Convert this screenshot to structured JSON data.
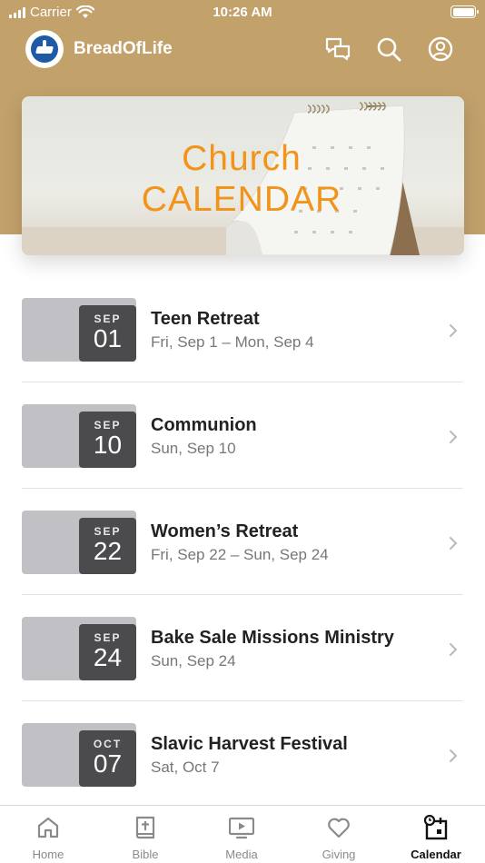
{
  "status_bar": {
    "carrier": "Carrier",
    "time": "10:26 AM"
  },
  "header": {
    "app_name": "BreadOfLife"
  },
  "banner": {
    "line1": "Church",
    "line2": "CALENDAR"
  },
  "events": [
    {
      "month": "SEP",
      "day": "01",
      "title": "Teen Retreat",
      "date_range": "Fri, Sep 1 – Mon, Sep 4"
    },
    {
      "month": "SEP",
      "day": "10",
      "title": "Communion",
      "date_range": "Sun, Sep 10"
    },
    {
      "month": "SEP",
      "day": "22",
      "title": "Women’s Retreat",
      "date_range": "Fri, Sep 22 – Sun, Sep 24"
    },
    {
      "month": "SEP",
      "day": "24",
      "title": "Bake Sale Missions Ministry",
      "date_range": "Sun, Sep 24"
    },
    {
      "month": "OCT",
      "day": "07",
      "title": "Slavic Harvest Festival",
      "date_range": "Sat, Oct 7"
    }
  ],
  "tabs": [
    {
      "label": "Home",
      "icon": "home-icon"
    },
    {
      "label": "Bible",
      "icon": "bible-icon"
    },
    {
      "label": "Media",
      "icon": "media-icon"
    },
    {
      "label": "Giving",
      "icon": "heart-icon"
    },
    {
      "label": "Calendar",
      "icon": "calendar-icon",
      "active": true
    }
  ],
  "colors": {
    "header": "#c2a16b",
    "accent": "#f19419",
    "date_dark": "#4b4b4d",
    "date_light": "#c1c1c5"
  }
}
